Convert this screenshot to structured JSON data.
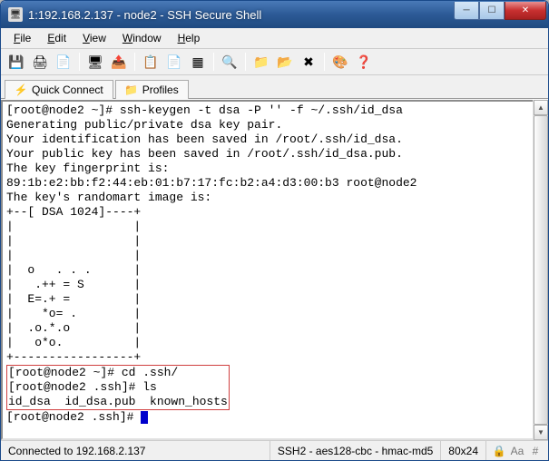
{
  "window": {
    "title": "1:192.168.2.137 - node2 - SSH Secure Shell"
  },
  "menu": {
    "file": "File",
    "edit": "Edit",
    "view": "View",
    "window": "Window",
    "help": "Help"
  },
  "toolbar_icons": {
    "save": "💾",
    "print": "🖨",
    "printview": "📄",
    "shell": "🖥",
    "transfer": "📤",
    "copy": "📋",
    "paste": "📄",
    "grid": "▦",
    "find": "🔍",
    "folder1": "📁",
    "folder2": "📂",
    "disconnect": "✖",
    "colors": "🎨",
    "help": "❓"
  },
  "tabs": {
    "quick_connect": "Quick Connect",
    "profiles": "Profiles"
  },
  "terminal": {
    "lines_top": "[root@node2 ~]# ssh-keygen -t dsa -P '' -f ~/.ssh/id_dsa\nGenerating public/private dsa key pair.\nYour identification has been saved in /root/.ssh/id_dsa.\nYour public key has been saved in /root/.ssh/id_dsa.pub.\nThe key fingerprint is:\n89:1b:e2:bb:f2:44:eb:01:b7:17:fc:b2:a4:d3:00:b3 root@node2\nThe key's randomart image is:\n+--[ DSA 1024]----+\n|                 |\n|                 |\n|                 |\n|  o   . . .      |\n|   .++ = S       |\n|  E=.+ =         |\n|    *o= .        |\n|  .o.*.o         |\n|   o*o.          |\n+-----------------+",
    "boxed": "[root@node2 ~]# cd .ssh/\n[root@node2 .ssh]# ls\nid_dsa  id_dsa.pub  known_hosts",
    "prompt_after": "[root@node2 .ssh]# "
  },
  "status": {
    "connection": "Connected to 192.168.2.137",
    "cipher": "SSH2 - aes128-cbc - hmac-md5",
    "size": "80x24"
  }
}
